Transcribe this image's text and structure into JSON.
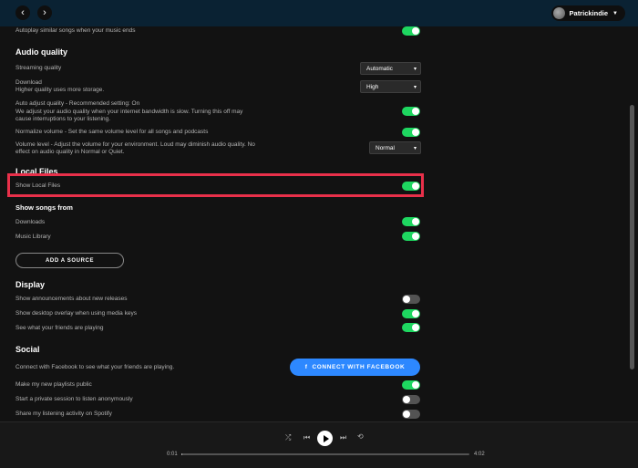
{
  "topbar": {
    "back_glyph": "‹",
    "forward_glyph": "›",
    "username": "Patrickindie",
    "caret_glyph": "▼"
  },
  "settings": {
    "autoplay_label": "Autoplay similar songs when your music ends",
    "audio_quality": {
      "heading": "Audio quality",
      "streaming_label": "Streaming quality",
      "streaming_value": "Automatic",
      "download_label": "Download",
      "download_sub": "Higher quality uses more storage.",
      "download_value": "High",
      "auto_adjust_line1": "Auto adjust quality - Recommended setting: On",
      "auto_adjust_line2": "We adjust your audio quality when your internet bandwidth is slow. Turning this off may",
      "auto_adjust_line3": "cause interruptions to your listening.",
      "normalize_label": "Normalize volume - Set the same volume level for all songs and podcasts",
      "volume_level_line1": "Volume level - Adjust the volume for your environment. Loud may diminish audio quality. No",
      "volume_level_line2": "effect on audio quality in Normal or Quiet.",
      "volume_level_value": "Normal"
    },
    "local_files": {
      "heading": "Local Files",
      "show_local_label": "Show Local Files",
      "show_songs_heading": "Show songs from",
      "downloads_label": "Downloads",
      "music_library_label": "Music Library",
      "add_source_label": "ADD A SOURCE"
    },
    "display": {
      "heading": "Display",
      "announcements_label": "Show announcements about new releases",
      "desktop_overlay_label": "Show desktop overlay when using media keys",
      "friends_playing_label": "See what your friends are playing"
    },
    "social": {
      "heading": "Social",
      "connect_fb_text": "Connect with Facebook to see what your friends are playing.",
      "connect_fb_button": "CONNECT WITH FACEBOOK",
      "fb_glyph": "f",
      "public_playlists_label": "Make my new playlists public",
      "private_session_label": "Start a private session to listen anonymously",
      "share_activity_label": "Share my listening activity on Spotify"
    },
    "toggles": {
      "autoplay": true,
      "auto_adjust": true,
      "normalize": true,
      "show_local": true,
      "downloads": true,
      "music_library": true,
      "announcements": false,
      "desktop_overlay": true,
      "friends_playing": true,
      "public_playlists": true,
      "private_session": false,
      "share_activity": false
    }
  },
  "player": {
    "elapsed": "0:01",
    "duration": "4:02",
    "progress_fraction": 0.004,
    "shuffle_glyph": "⤮",
    "prev_glyph": "⏮",
    "next_glyph": "⏭",
    "repeat_glyph": "⟲"
  },
  "colors": {
    "accent_green": "#1ed760",
    "highlight_red": "#e8304a",
    "facebook_blue": "#2d88ff"
  }
}
